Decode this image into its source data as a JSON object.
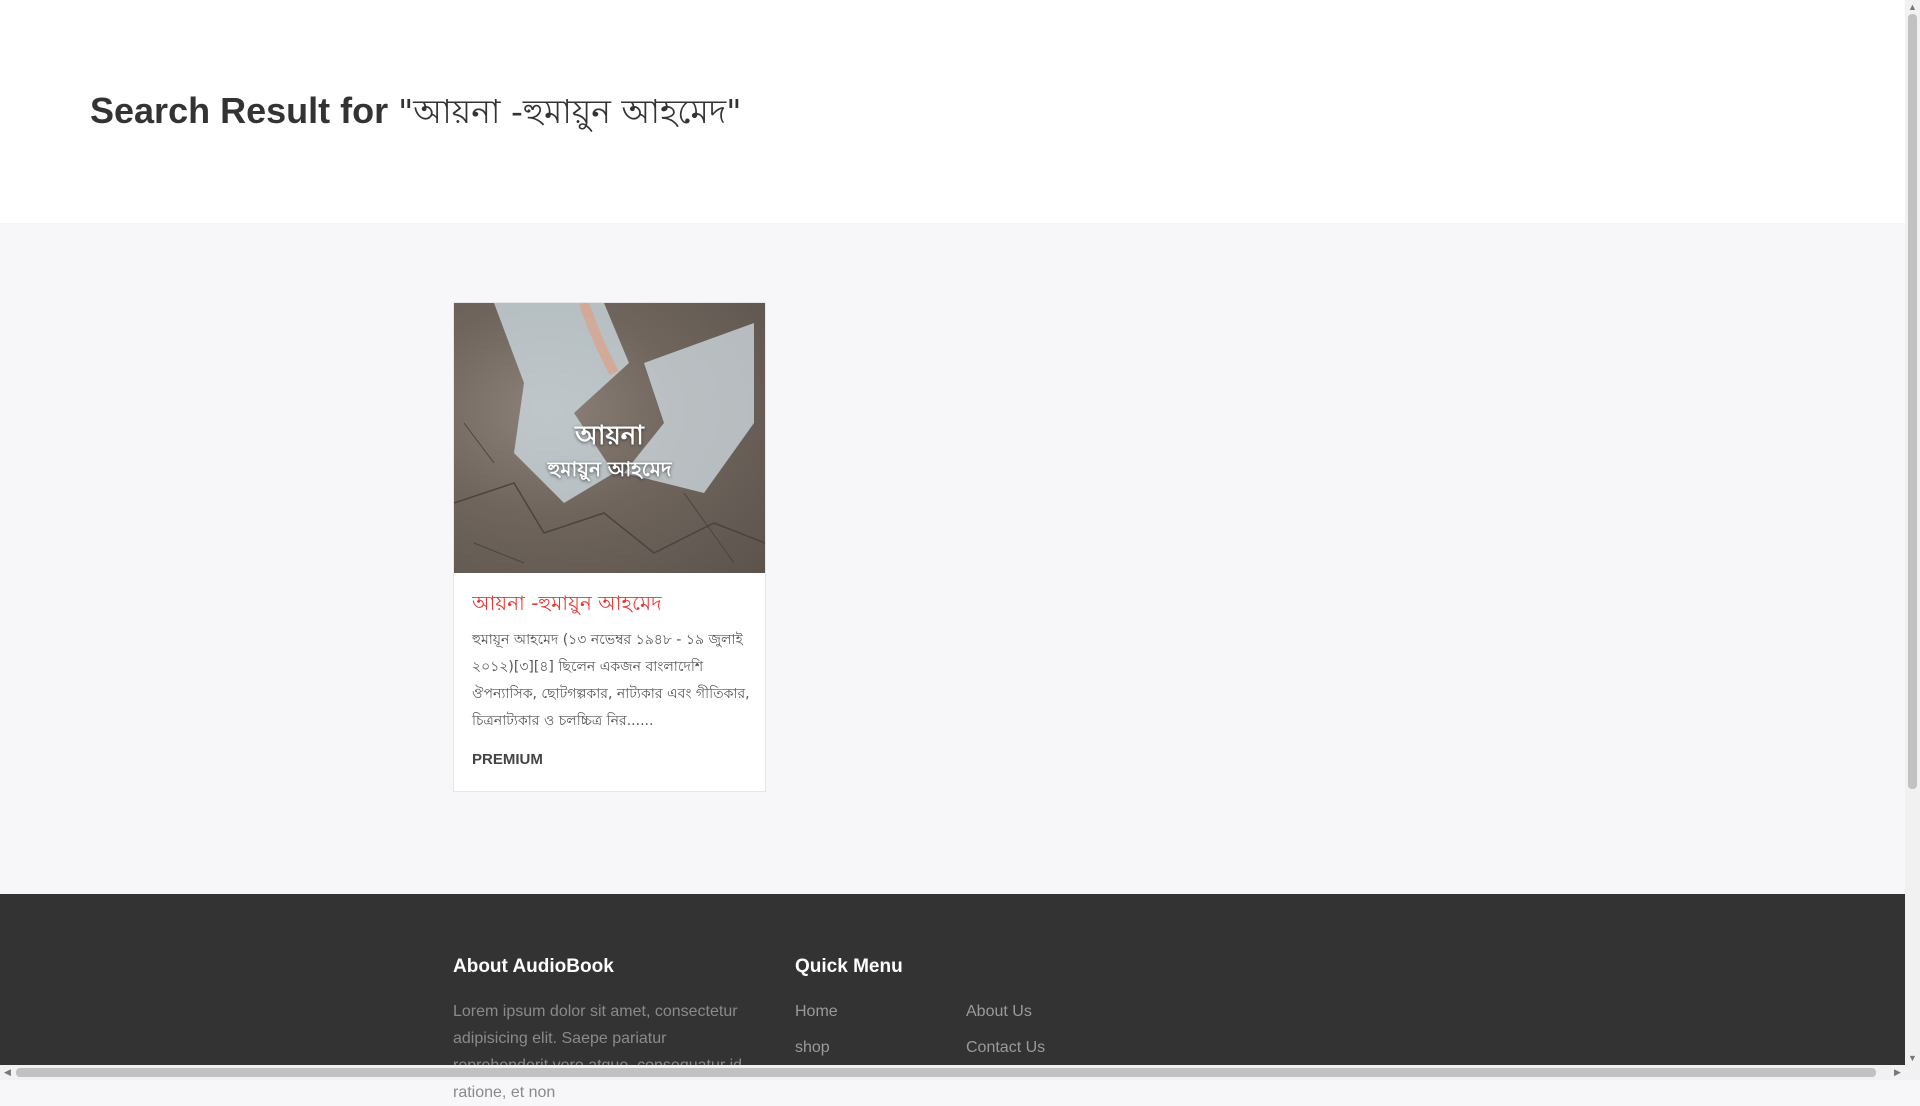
{
  "header": {
    "title_prefix": "Search Result for ",
    "query": "\"আয়না -হুমায়ুন আহমেদ\""
  },
  "results": [
    {
      "cover_title": "আয়না",
      "cover_author": "হুমায়ুন আহমেদ",
      "title": "আয়না -হুমায়ুন আহমেদ",
      "description": "হুমায়ূন আহমেদ (১৩ নভেম্বর ১৯৪৮ - ১৯ জুলাই ২০১২)[৩][৪] ছিলেন একজন বাংলাদেশি ঔপন্যাসিক, ছোটগল্পকার, নাট্যকার এবং গীতিকার, চিত্রনাট্যকার ও চলচ্চিত্র নির......",
      "badge": "PREMIUM"
    }
  ],
  "footer": {
    "about_heading": "About AudioBook",
    "about_text": "Lorem ipsum dolor sit amet, consectetur adipisicing elit. Saepe pariatur reprehenderit vero atque, consequatur id ratione, et non",
    "quick_menu_heading": "Quick Menu",
    "links": [
      "Home",
      "About Us",
      "shop",
      "Contact Us"
    ]
  },
  "colors": {
    "accent": "#e53935",
    "footer_bg": "#333333",
    "page_bg": "#f7f7f9"
  },
  "icons": {
    "scroll_up": "triangle-up-icon",
    "scroll_down": "triangle-down-icon",
    "scroll_left": "triangle-left-icon",
    "scroll_right": "triangle-right-icon"
  }
}
